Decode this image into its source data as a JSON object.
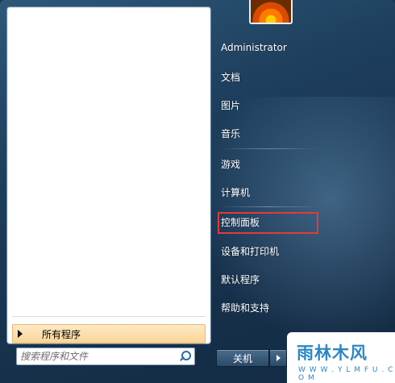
{
  "left_pane": {
    "all_programs_label": "所有程序",
    "search_placeholder": "搜索程序和文件"
  },
  "right_pane": {
    "user_name": "Administrator",
    "items": [
      "文档",
      "图片",
      "音乐",
      "游戏",
      "计算机",
      "控制面板",
      "设备和打印机",
      "默认程序",
      "帮助和支持"
    ],
    "highlighted_item": "控制面板"
  },
  "footer": {
    "shutdown_label": "关机"
  },
  "watermark": {
    "main_text": "雨林木风",
    "sub_text": "W W W . Y L M F U . C O M"
  },
  "colors": {
    "highlight_border": "#e43a3a",
    "all_programs_bg": "#fbd597",
    "menu_bg": "#1d3e5c"
  },
  "icons": {
    "search": "search-icon",
    "all_programs_arrow": "triangle-right-icon",
    "shutdown_arrow": "triangle-right-icon",
    "user_picture": "flower-avatar"
  }
}
